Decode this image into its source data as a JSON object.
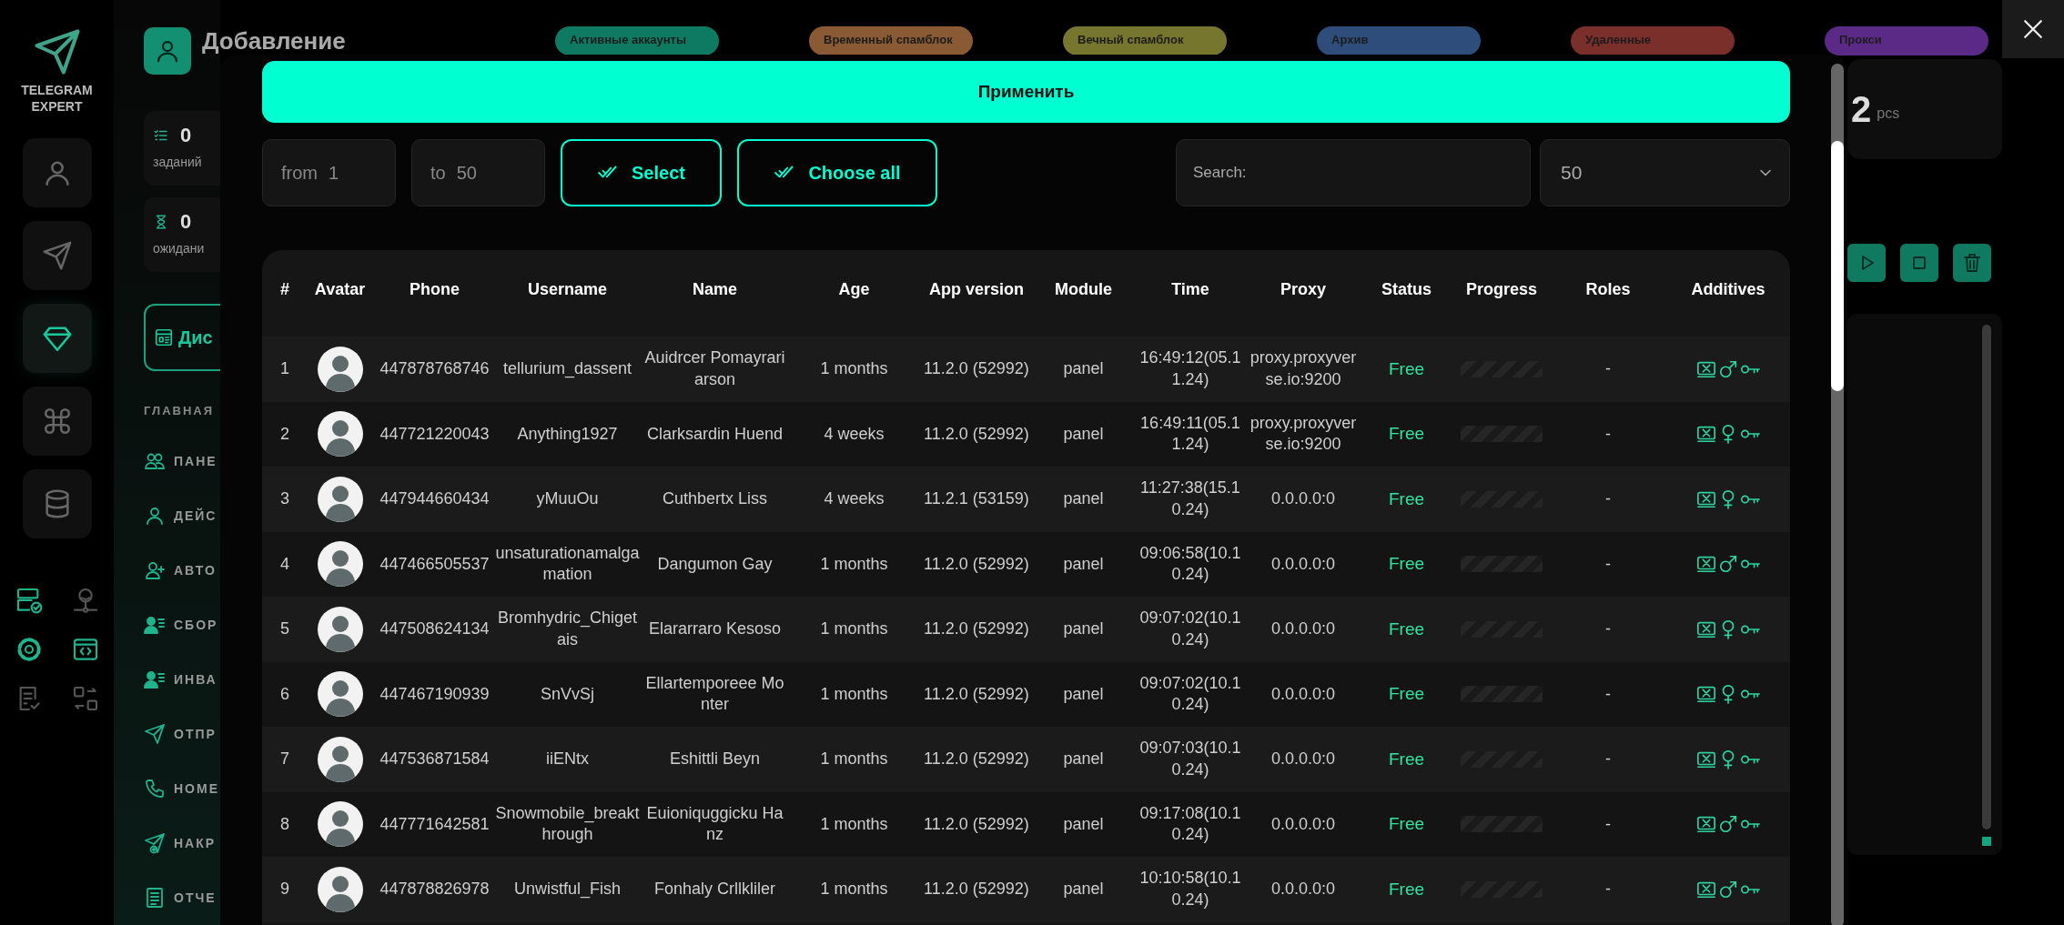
{
  "brand": {
    "name": "TELEGRAM EXPERT"
  },
  "rail": [
    {
      "selected": false
    },
    {
      "selected": false
    },
    {
      "selected": true
    },
    {
      "selected": false
    },
    {
      "selected": false
    }
  ],
  "tools": [
    {
      "active": true
    },
    {
      "active": false
    },
    {
      "active": true
    },
    {
      "active": true
    },
    {
      "active": false
    },
    {
      "active": false
    }
  ],
  "sidebar": {
    "title": "Добавление",
    "stats": [
      {
        "value": "0",
        "label": "заданий"
      },
      {
        "value": "0",
        "label": "ожидани"
      }
    ],
    "button": "Дис",
    "section": "ГЛАВНАЯ",
    "items": [
      "ПАНЕ",
      "ДЕЙС",
      "АВТО",
      "СБОР",
      "ИНВА",
      "ОТПР",
      "НОМЕ",
      "НАКР",
      "ОТЧЕ"
    ]
  },
  "status_tabs": [
    {
      "label": "Активные аккаунты",
      "color": "#0f7a62"
    },
    {
      "label": "Временный спамблок",
      "color": "#8a5a34"
    },
    {
      "label": "Вечный спамблок",
      "color": "#77762e"
    },
    {
      "label": "Архив",
      "color": "#2e4d7a"
    },
    {
      "label": "Удаленные",
      "color": "#7a2f2b"
    },
    {
      "label": "Прокси",
      "color": "#5a2a86"
    }
  ],
  "summary": {
    "value": "2",
    "unit": "pcs"
  },
  "modal": {
    "apply": "Применить",
    "from": {
      "label": "from",
      "value": "1"
    },
    "to": {
      "label": "to",
      "value": "50"
    },
    "select": "Select",
    "choose_all": "Choose all",
    "search": {
      "placeholder": "Search:"
    },
    "page_size": "50",
    "table": {
      "columns": [
        "#",
        "Avatar",
        "Phone",
        "Username",
        "Name",
        "Age",
        "App version",
        "Module",
        "Time",
        "Proxy",
        "Status",
        "Progress",
        "Roles",
        "Additives"
      ],
      "rows": [
        {
          "num": "1",
          "phone": "447878768746",
          "username": "tellurium_dassent",
          "name": "Auidrcer Pomayrariarson",
          "age": "1 months",
          "app_version": "11.2.0 (52992)",
          "module": "panel",
          "time": "16:49:12(05.11.24)",
          "proxy": "proxy.proxyverse.io:9200",
          "status": "Free",
          "roles": "-",
          "kind": "male",
          "level": 0
        },
        {
          "num": "2",
          "phone": "447721220043",
          "username": "Anything1927",
          "name": "Clarksardin Huend",
          "age": "4 weeks",
          "app_version": "11.2.0 (52992)",
          "module": "panel",
          "time": "16:49:11(05.11.24)",
          "proxy": "proxy.proxyverse.io:9200",
          "status": "Free",
          "roles": "-",
          "kind": "female",
          "level": 0
        },
        {
          "num": "3",
          "phone": "447944660434",
          "username": "yMuuOu",
          "name": "Cuthbertx Liss",
          "age": "4 weeks",
          "app_version": "11.2.1 (53159)",
          "module": "panel",
          "time": "11:27:38(15.10.24)",
          "proxy": "0.0.0.0:0",
          "status": "Free",
          "roles": "-",
          "kind": "female",
          "level": 0
        },
        {
          "num": "4",
          "phone": "447466505537",
          "username": "unsaturationamalgamation",
          "name": "Dangumon Gay",
          "age": "1 months",
          "app_version": "11.2.0 (52992)",
          "module": "panel",
          "time": "09:06:58(10.10.24)",
          "proxy": "0.0.0.0:0",
          "status": "Free",
          "roles": "-",
          "kind": "male",
          "level": 0
        },
        {
          "num": "5",
          "phone": "447508624134",
          "username": "Bromhydric_Chigetais",
          "name": "Elararraro Kesoso",
          "age": "1 months",
          "app_version": "11.2.0 (52992)",
          "module": "panel",
          "time": "09:07:02(10.10.24)",
          "proxy": "0.0.0.0:0",
          "status": "Free",
          "roles": "-",
          "kind": "female",
          "level": 0
        },
        {
          "num": "6",
          "phone": "447467190939",
          "username": "SnVvSj",
          "name": "Ellartemporeee Monter",
          "age": "1 months",
          "app_version": "11.2.0 (52992)",
          "module": "panel",
          "time": "09:07:02(10.10.24)",
          "proxy": "0.0.0.0:0",
          "status": "Free",
          "roles": "-",
          "kind": "female",
          "level": 0
        },
        {
          "num": "7",
          "phone": "447536871584",
          "username": "iiENtx",
          "name": "Eshittli Beyn",
          "age": "1 months",
          "app_version": "11.2.0 (52992)",
          "module": "panel",
          "time": "09:07:03(10.10.24)",
          "proxy": "0.0.0.0:0",
          "status": "Free",
          "roles": "-",
          "kind": "female",
          "level": 0
        },
        {
          "num": "8",
          "phone": "447771642581",
          "username": "Snowmobile_breakthrough",
          "name": "Euioniquggicku Hanz",
          "age": "1 months",
          "app_version": "11.2.0 (52992)",
          "module": "panel",
          "time": "09:17:08(10.10.24)",
          "proxy": "0.0.0.0:0",
          "status": "Free",
          "roles": "-",
          "kind": "male",
          "level": 0
        },
        {
          "num": "9",
          "phone": "447878826978",
          "username": "Unwistful_Fish",
          "name": "Fonhaly Crllkliler",
          "age": "1 months",
          "app_version": "11.2.0 (52992)",
          "module": "panel",
          "time": "10:10:58(10.10.24)",
          "proxy": "0.0.0.0:0",
          "status": "Free",
          "roles": "-",
          "kind": "male",
          "level": 0
        }
      ]
    }
  }
}
